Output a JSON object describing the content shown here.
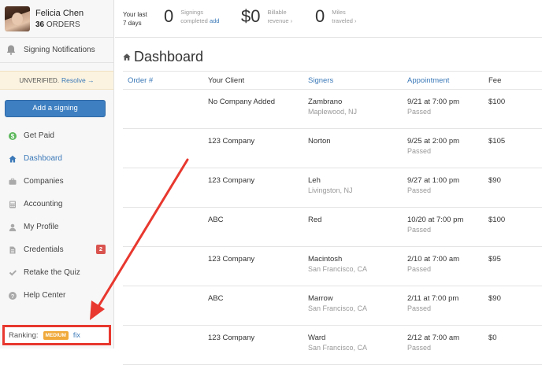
{
  "profile": {
    "name": "Felicia Chen",
    "orders_count": "36",
    "orders_label": "ORDERS"
  },
  "notifications": {
    "label": "Signing Notifications"
  },
  "verification": {
    "status": "UNVERIFIED.",
    "resolve": "Resolve →"
  },
  "add_signing": "Add a signing",
  "sidebar": {
    "items": [
      {
        "label": "Get Paid",
        "icon": "dollar-icon"
      },
      {
        "label": "Dashboard",
        "icon": "home-icon"
      },
      {
        "label": "Companies",
        "icon": "briefcase-icon"
      },
      {
        "label": "Accounting",
        "icon": "calculator-icon"
      },
      {
        "label": "My Profile",
        "icon": "user-icon"
      },
      {
        "label": "Credentials",
        "icon": "document-icon",
        "badge": "2"
      },
      {
        "label": "Retake the Quiz",
        "icon": "check-icon"
      },
      {
        "label": "Help Center",
        "icon": "question-icon"
      }
    ]
  },
  "ranking": {
    "label": "Ranking:",
    "level": "MEDIUM",
    "fix": "fix"
  },
  "stats": {
    "period_line1": "Your last",
    "period_line2": "7 days",
    "signings_value": "0",
    "signings_label1": "Signings",
    "signings_label2": "completed",
    "signings_add": "add",
    "revenue_value": "$0",
    "revenue_label1": "Billable",
    "revenue_label2": "revenue ›",
    "miles_value": "0",
    "miles_label1": "Miles",
    "miles_label2": "traveled ›"
  },
  "page_title": "Dashboard",
  "table": {
    "headers": {
      "order": "Order #",
      "client": "Your Client",
      "signers": "Signers",
      "appointment": "Appointment",
      "fee": "Fee"
    },
    "rows": [
      {
        "client": "No Company Added",
        "signer": "Zambrano",
        "location": "Maplewood, NJ",
        "time": "9/21 at 7:00 pm",
        "status": "Passed",
        "fee": "$100"
      },
      {
        "client": "123 Company",
        "signer": "Norton",
        "location": "",
        "time": "9/25 at 2:00 pm",
        "status": "Passed",
        "fee": "$105"
      },
      {
        "client": "123 Company",
        "signer": "Leh",
        "location": "Livingston, NJ",
        "time": "9/27 at 1:00 pm",
        "status": "Passed",
        "fee": "$90"
      },
      {
        "client": "ABC",
        "signer": "Red",
        "location": "",
        "time": "10/20 at 7:00 pm",
        "status": "Passed",
        "fee": "$100"
      },
      {
        "client": "123 Company",
        "signer": "Macintosh",
        "location": "San Francisco, CA",
        "time": "2/10 at 7:00 am",
        "status": "Passed",
        "fee": "$95"
      },
      {
        "client": "ABC",
        "signer": "Marrow",
        "location": "San Francisco, CA",
        "time": "2/11 at 7:00 pm",
        "status": "Passed",
        "fee": "$90"
      },
      {
        "client": "123 Company",
        "signer": "Ward",
        "location": "San Francisco, CA",
        "time": "2/12 at 7:00 am",
        "status": "Passed",
        "fee": "$0"
      }
    ]
  },
  "colors": {
    "accent": "#3b79b8",
    "highlight": "#e8382f",
    "badge": "#d9534f",
    "medium": "#f0a93a",
    "unverified_bg": "#fbf3e0"
  }
}
